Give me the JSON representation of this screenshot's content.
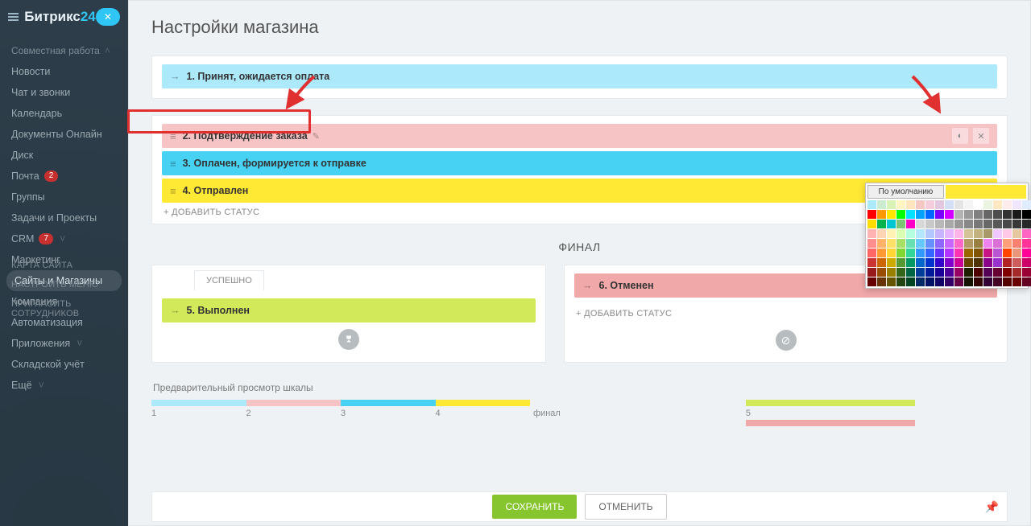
{
  "logo": {
    "brand": "Битрикс",
    "suffix": "24"
  },
  "sidebar": {
    "items": [
      {
        "label": "Совместная работа",
        "kind": "section"
      },
      {
        "label": "Новости"
      },
      {
        "label": "Чат и звонки"
      },
      {
        "label": "Календарь"
      },
      {
        "label": "Документы Онлайн"
      },
      {
        "label": "Диск"
      },
      {
        "label": "Почта",
        "badge": "2"
      },
      {
        "label": "Группы"
      },
      {
        "label": "Задачи и Проекты"
      },
      {
        "label": "CRM",
        "badge": "7"
      },
      {
        "label": "Маркетинг"
      },
      {
        "label": "Сайты и Магазины",
        "active": true
      },
      {
        "label": "Компания"
      },
      {
        "label": "Автоматизация"
      },
      {
        "label": "Приложения"
      },
      {
        "label": "Складской учёт"
      },
      {
        "label": "Ещё"
      }
    ],
    "footer": [
      "КАРТА САЙТА",
      "НАСТРОИТЬ МЕНЮ",
      "ПРИГЛАСИТЬ СОТРУДНИКОВ"
    ]
  },
  "page_title": "Настройки магазина",
  "statuses": {
    "accepted": "1. Принят, ожидается оплата",
    "confirm": "2. Подтверждение заказа",
    "paid": "3. Оплачен, формируется к отправке",
    "sent": "4. Отправлен"
  },
  "add_status": "ДОБАВИТЬ СТАТУС",
  "final_label": "ФИНАЛ",
  "success_tab": "УСПЕШНО",
  "done_status": "5. Выполнен",
  "cancel_status": "6. Отменен",
  "preview_label": "Предварительный просмотр шкалы",
  "scale_nums": [
    "1",
    "2",
    "3",
    "4"
  ],
  "scale_side": "5",
  "scale_final": "финал",
  "buttons": {
    "save": "СОХРАНИТЬ",
    "cancel": "ОТМЕНИТЬ"
  },
  "color_picker": {
    "default_label": "По умолчанию"
  },
  "palette_colors": [
    "#ACE9FB",
    "#CBECCE",
    "#D9F3B6",
    "#FFF5C2",
    "#FFE5BD",
    "#F5C8C3",
    "#F3CDDB",
    "#E2C7E0",
    "#D4DFF5",
    "#E4E4E4",
    "#F4F4F4",
    "#FFFFFF",
    "#EAF4E0",
    "#FFE8C2",
    "#FFECEC",
    "#F1E6FF",
    "#E0ECFF",
    "#FF0000",
    "#FF9900",
    "#FFE600",
    "#00FF00",
    "#00E2FF",
    "#00A2FF",
    "#0066FF",
    "#7B00FF",
    "#D400FF",
    "#B2B2B2",
    "#999999",
    "#808080",
    "#666666",
    "#4D4D4D",
    "#333333",
    "#1A1A1A",
    "#000000",
    "#FFDD00",
    "#00B34A",
    "#00C7D1",
    "#7CC576",
    "#FF00C8",
    "#D8D8D8",
    "#C8C8C8",
    "#B8B8B8",
    "#A8A8A8",
    "#989898",
    "#888888",
    "#787878",
    "#686868",
    "#585858",
    "#484848",
    "#383838",
    "#282828",
    "#FFB3B3",
    "#FFD4B3",
    "#FFF2B3",
    "#D9FFB3",
    "#B3FFE0",
    "#B3E6FF",
    "#B3C7FF",
    "#C7B3FF",
    "#E6B3FF",
    "#FFB3E6",
    "#D4C299",
    "#C2B280",
    "#A89968",
    "#F0C8FF",
    "#FFC8E6",
    "#E6C8A0",
    "#FF66C4",
    "#FF8F8F",
    "#FFB366",
    "#FFE066",
    "#A8E066",
    "#66E0B3",
    "#66C7FF",
    "#668FFF",
    "#8F66FF",
    "#C766FF",
    "#FF66C7",
    "#B39966",
    "#998040",
    "#EE82EE",
    "#DA70D6",
    "#FFA07A",
    "#FA8072",
    "#FF3399",
    "#FF6666",
    "#FF9933",
    "#FFD633",
    "#80D633",
    "#33D699",
    "#3399FF",
    "#3366FF",
    "#6633FF",
    "#B333FF",
    "#FF33B3",
    "#996600",
    "#805500",
    "#C71585",
    "#BA55D3",
    "#FF4500",
    "#E9967A",
    "#FF0099",
    "#CC3333",
    "#CC6600",
    "#CCAA00",
    "#559933",
    "#009966",
    "#0066CC",
    "#0033CC",
    "#3300CC",
    "#8000CC",
    "#CC0099",
    "#664400",
    "#4D3300",
    "#8B008B",
    "#9932CC",
    "#B22222",
    "#CD5C5C",
    "#CC0066",
    "#991A1A",
    "#994D00",
    "#998000",
    "#336619",
    "#006644",
    "#003D99",
    "#001A99",
    "#1A0099",
    "#4D0099",
    "#990066",
    "#1E1E00",
    "#4D0000",
    "#550055",
    "#660033",
    "#800000",
    "#A52A2A",
    "#990033",
    "#660000",
    "#663300",
    "#665500",
    "#224411",
    "#004422",
    "#002966",
    "#001166",
    "#110066",
    "#330066",
    "#660044",
    "#141400",
    "#330000",
    "#330033",
    "#440022",
    "#550000",
    "#6B0000",
    "#660022"
  ]
}
